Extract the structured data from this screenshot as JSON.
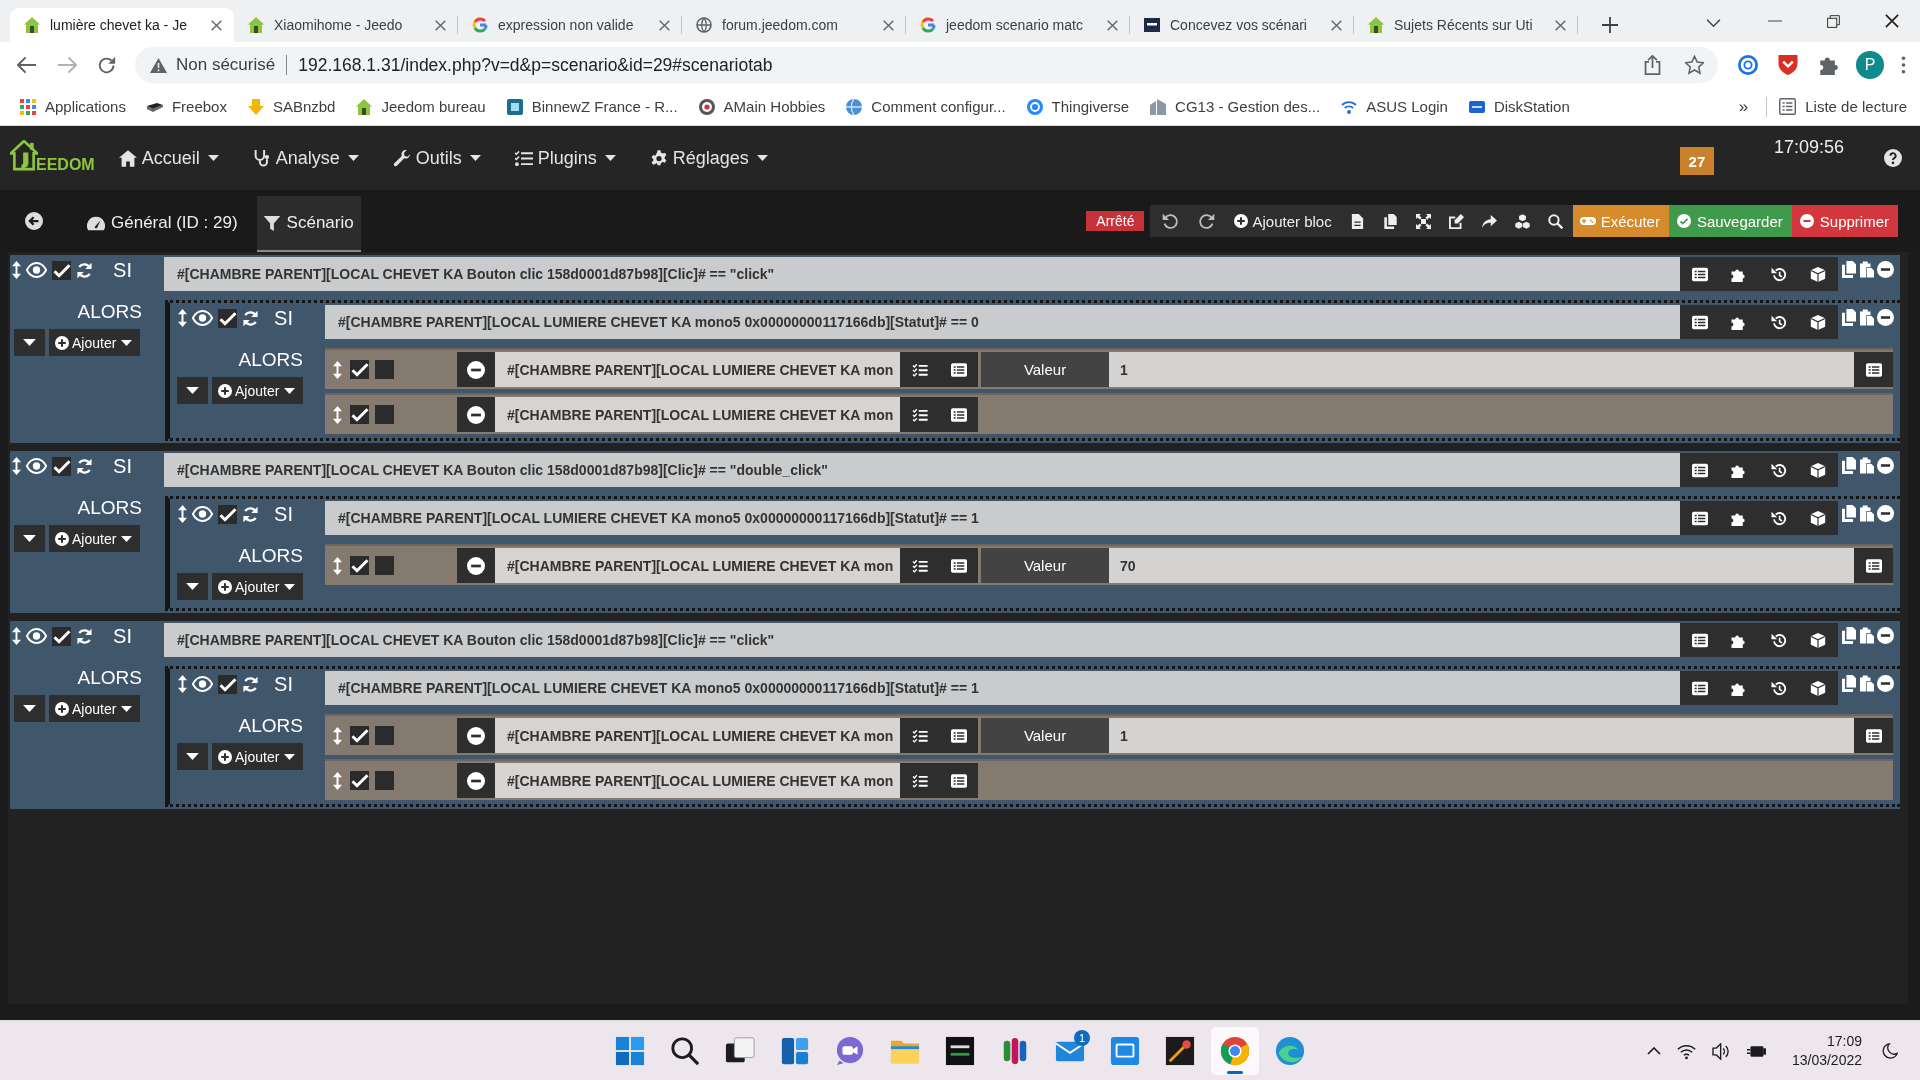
{
  "browser": {
    "tabs": [
      {
        "title": "lumière chevet ka - Je",
        "kind": "jeedom",
        "selected": true
      },
      {
        "title": "Xiaomihome - Jeedo",
        "kind": "jeedom",
        "selected": false
      },
      {
        "title": "expression non valide",
        "kind": "google",
        "selected": false
      },
      {
        "title": "forum.jeedom.com",
        "kind": "globe",
        "selected": false
      },
      {
        "title": "jeedom scenario matc",
        "kind": "google",
        "selected": false
      },
      {
        "title": "Concevez vos scénari",
        "kind": "dark",
        "selected": false
      },
      {
        "title": "Sujets Récents sur Uti",
        "kind": "jeedom",
        "selected": false
      }
    ],
    "security": "Non sécurisé",
    "url": "192.168.1.31/index.php?v=d&p=scenario&id=29#scenariotab",
    "profile": "P",
    "bookmarks": [
      {
        "label": "Applications",
        "kind": "apps"
      },
      {
        "label": "Freebox",
        "kind": "freebox"
      },
      {
        "label": "SABnzbd",
        "kind": "sab"
      },
      {
        "label": "Jeedom bureau",
        "kind": "jeedom"
      },
      {
        "label": "BinnewZ France - R...",
        "kind": "binnewz"
      },
      {
        "label": "AMain Hobbies",
        "kind": "amain"
      },
      {
        "label": "Comment configur...",
        "kind": "planet"
      },
      {
        "label": "Thingiverse",
        "kind": "thingiverse"
      },
      {
        "label": "CG13 - Gestion des...",
        "kind": "cg13"
      },
      {
        "label": "ASUS Login",
        "kind": "asus"
      },
      {
        "label": "DiskStation",
        "kind": "dsm"
      }
    ],
    "more": "»",
    "reading_list": "Liste de lecture"
  },
  "navbar": {
    "logo": "EEDOM",
    "menus": [
      {
        "label": "Accueil",
        "kind": "home"
      },
      {
        "label": "Analyse",
        "kind": "analysis"
      },
      {
        "label": "Outils",
        "kind": "tools"
      },
      {
        "label": "Plugins",
        "kind": "plugins"
      },
      {
        "label": "Réglages",
        "kind": "settings"
      }
    ],
    "badge": "27",
    "time": "17:09:56"
  },
  "scenario_bar": {
    "tabs": [
      {
        "label": "Général (ID : 29)",
        "kind": "general",
        "selected": false
      },
      {
        "label": "Scénario",
        "kind": "scenario",
        "selected": true
      }
    ],
    "status": "Arrêté",
    "add_block": "Ajouter bloc",
    "actions": [
      {
        "label": "Exécuter",
        "kind": "run"
      },
      {
        "label": "Sauvegarder",
        "kind": "save"
      },
      {
        "label": "Supprimer",
        "kind": "delete"
      }
    ]
  },
  "blocks": [
    {
      "kind": "if",
      "if_label": "SI",
      "condition": "#[CHAMBRE PARENT][LOCAL CHEVET KA Bouton clic 158d0001d87b98][Clic]# == \"click\"",
      "then_label": "ALORS",
      "add_label": "Ajouter",
      "enabled": true,
      "children": [
        {
          "kind": "if",
          "if_label": "SI",
          "condition": "#[CHAMBRE PARENT][LOCAL LUMIERE CHEVET KA mono5 0x00000000117166db][Statut]# == 0",
          "then_label": "ALORS",
          "add_label": "Ajouter",
          "enabled": true,
          "children": [
            {
              "kind": "action",
              "enabled": true,
              "parallel": false,
              "command": "#[CHAMBRE PARENT][LOCAL LUMIERE CHEVET KA mon",
              "option_label": "Valeur",
              "option_value": "1"
            },
            {
              "kind": "action",
              "enabled": true,
              "parallel": false,
              "command": "#[CHAMBRE PARENT][LOCAL LUMIERE CHEVET KA mon"
            }
          ]
        }
      ]
    },
    {
      "kind": "if",
      "if_label": "SI",
      "condition": "#[CHAMBRE PARENT][LOCAL CHEVET KA Bouton clic 158d0001d87b98][Clic]# == \"double_click\"",
      "then_label": "ALORS",
      "add_label": "Ajouter",
      "enabled": true,
      "children": [
        {
          "kind": "if",
          "if_label": "SI",
          "condition": "#[CHAMBRE PARENT][LOCAL LUMIERE CHEVET KA mono5 0x00000000117166db][Statut]# == 1",
          "then_label": "ALORS",
          "add_label": "Ajouter",
          "enabled": true,
          "children": [
            {
              "kind": "action",
              "enabled": true,
              "parallel": false,
              "command": "#[CHAMBRE PARENT][LOCAL LUMIERE CHEVET KA mon",
              "option_label": "Valeur",
              "option_value": "70"
            }
          ]
        }
      ]
    },
    {
      "kind": "if",
      "if_label": "SI",
      "condition": "#[CHAMBRE PARENT][LOCAL CHEVET KA Bouton clic 158d0001d87b98][Clic]# == \"click\"",
      "then_label": "ALORS",
      "add_label": "Ajouter",
      "enabled": true,
      "children": [
        {
          "kind": "if",
          "if_label": "SI",
          "condition": "#[CHAMBRE PARENT][LOCAL LUMIERE CHEVET KA mono5 0x00000000117166db][Statut]# == 1",
          "then_label": "ALORS",
          "add_label": "Ajouter",
          "enabled": true,
          "children": [
            {
              "kind": "action",
              "enabled": true,
              "parallel": false,
              "command": "#[CHAMBRE PARENT][LOCAL LUMIERE CHEVET KA mon",
              "option_label": "Valeur",
              "option_value": "1"
            },
            {
              "kind": "action",
              "enabled": true,
              "parallel": false,
              "command": "#[CHAMBRE PARENT][LOCAL LUMIERE CHEVET KA mon"
            }
          ]
        }
      ]
    }
  ],
  "taskbar": {
    "apps": [
      {
        "kind": "start",
        "selected": false
      },
      {
        "kind": "search",
        "selected": false
      },
      {
        "kind": "taskview",
        "selected": false
      },
      {
        "kind": "widgets",
        "selected": false
      },
      {
        "kind": "chat",
        "selected": false
      },
      {
        "kind": "explorer",
        "selected": false
      },
      {
        "kind": "opentx",
        "selected": false
      },
      {
        "kind": "bars",
        "selected": false
      },
      {
        "kind": "mail",
        "selected": false,
        "badge": "1"
      },
      {
        "kind": "vnc",
        "selected": false
      },
      {
        "kind": "space",
        "selected": false
      },
      {
        "kind": "chrome",
        "selected": true
      },
      {
        "kind": "edge",
        "selected": false
      }
    ],
    "time": "17:09",
    "date": "13/03/2022"
  }
}
